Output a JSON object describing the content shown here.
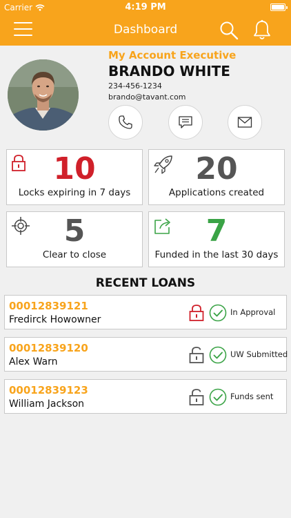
{
  "status_bar": {
    "carrier": "Carrier",
    "time": "4:19 PM",
    "battery_level": 1.0
  },
  "nav": {
    "title": "Dashboard"
  },
  "profile": {
    "role": "My Account Executive",
    "name": "BRANDO WHITE",
    "phone": "234-456-1234",
    "email": "brando@tavant.com"
  },
  "stats": [
    {
      "value": "10",
      "label": "Locks expiring in 7 days",
      "color": "#d0202a",
      "icon": "lock-icon"
    },
    {
      "value": "20",
      "label": "Applications created",
      "color": "#555555",
      "icon": "rocket-icon"
    },
    {
      "value": "5",
      "label": "Clear to close",
      "color": "#555555",
      "icon": "target-icon"
    },
    {
      "value": "7",
      "label": "Funded in the last 30 days",
      "color": "#3aa346",
      "icon": "share-icon"
    }
  ],
  "recent": {
    "title": "RECENT LOANS",
    "loans": [
      {
        "number": "00012839121",
        "name": "Fredirck Howowner",
        "status": "In Approval",
        "lock": "locked"
      },
      {
        "number": "00012839120",
        "name": "Alex Warn",
        "status": "UW Submitted",
        "lock": "unlocked"
      },
      {
        "number": "00012839123",
        "name": "William Jackson",
        "status": "Funds sent",
        "lock": "unlocked"
      }
    ]
  },
  "colors": {
    "accent": "#f8a41c",
    "red": "#d0202a",
    "green": "#3aa346"
  }
}
